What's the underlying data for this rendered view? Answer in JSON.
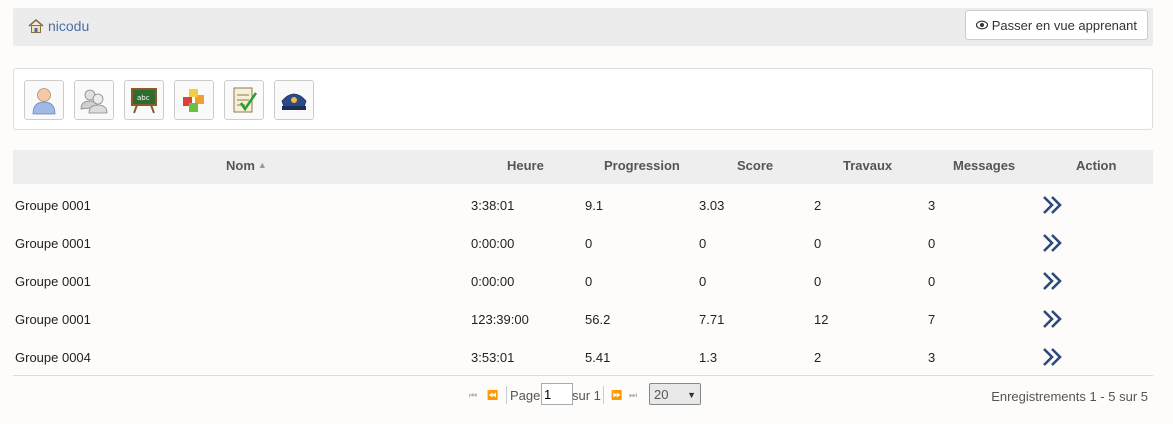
{
  "header": {
    "breadcrumb": "nicodu",
    "learner_button": "Passer en vue apprenant"
  },
  "toolbar": {
    "tools": [
      {
        "icon": "user-icon"
      },
      {
        "icon": "group-icon"
      },
      {
        "icon": "chalkboard-icon"
      },
      {
        "icon": "blocks-icon"
      },
      {
        "icon": "checklist-icon"
      },
      {
        "icon": "badge-icon"
      }
    ]
  },
  "table": {
    "headers": {
      "nom": "Nom",
      "heure": "Heure",
      "progression": "Progression",
      "score": "Score",
      "travaux": "Travaux",
      "messages": "Messages",
      "action": "Action"
    },
    "rows": [
      {
        "nom": "Groupe 0001",
        "heure": "3:38:01",
        "progression": "9.1",
        "score": "3.03",
        "travaux": "2",
        "messages": "3"
      },
      {
        "nom": "Groupe 0001",
        "heure": "0:00:00",
        "progression": "0",
        "score": "0",
        "travaux": "0",
        "messages": "0"
      },
      {
        "nom": "Groupe 0001",
        "heure": "0:00:00",
        "progression": "0",
        "score": "0",
        "travaux": "0",
        "messages": "0"
      },
      {
        "nom": "Groupe 0001",
        "heure": "123:39:00",
        "progression": "56.2",
        "score": "7.71",
        "travaux": "12",
        "messages": "7"
      },
      {
        "nom": "Groupe 0004",
        "heure": "3:53:01",
        "progression": "5.41",
        "score": "1.3",
        "travaux": "2",
        "messages": "3"
      }
    ]
  },
  "pager": {
    "page_label": "Page",
    "page_value": "1",
    "of_label": "sur 1",
    "rows_per_page": "20",
    "records": "Enregistrements 1 - 5 sur 5"
  },
  "colors": {
    "accent": "#4a6fa5",
    "action_icon": "#2c4a7a"
  }
}
